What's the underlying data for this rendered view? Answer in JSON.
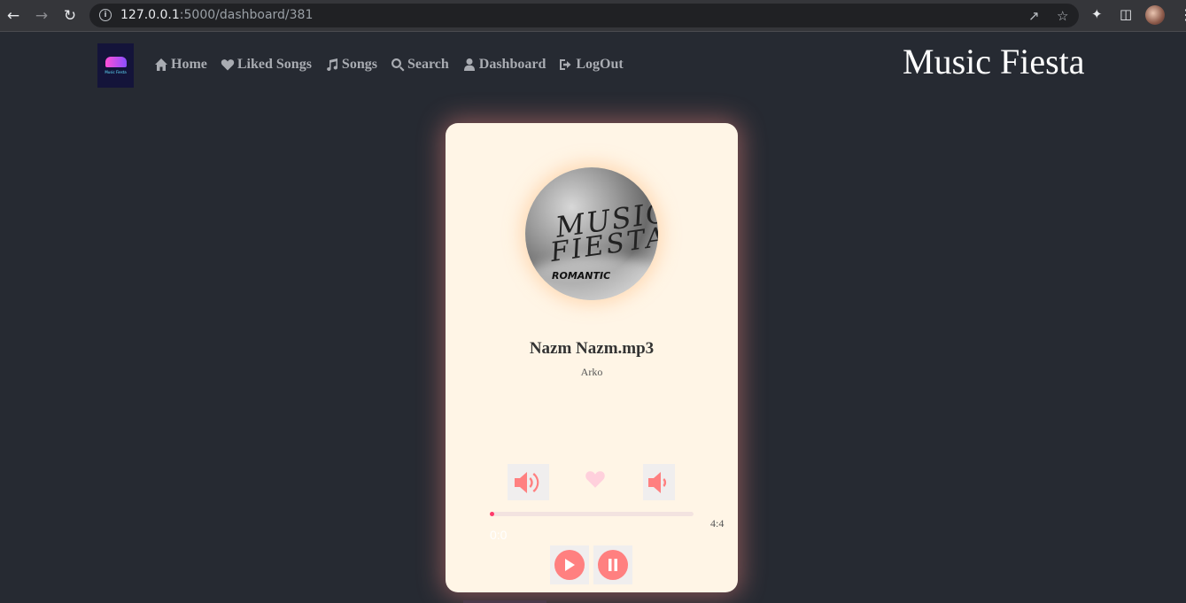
{
  "browser": {
    "url_host": "127.0.0.1",
    "url_path": ":5000/dashboard/381",
    "icons": [
      "back-icon",
      "forward-icon",
      "reload-icon",
      "info-icon",
      "share-icon",
      "star-icon",
      "extensions-icon",
      "sidepanel-icon",
      "profile-avatar",
      "menu-icon"
    ]
  },
  "site": {
    "logo_text": "Music Fiesta",
    "brand": "Music Fiesta",
    "nav": [
      {
        "label": "Home",
        "icon": "home-icon"
      },
      {
        "label": "Liked Songs",
        "icon": "heart-icon"
      },
      {
        "label": "Songs",
        "icon": "music-note-icon"
      },
      {
        "label": "Search",
        "icon": "search-icon"
      },
      {
        "label": "Dashboard",
        "icon": "user-icon"
      },
      {
        "label": "LogOut",
        "icon": "logout-icon"
      }
    ]
  },
  "player": {
    "cover_text": [
      "MUSIC",
      "FIESTA",
      "ROMANTIC"
    ],
    "title": "Nazm Nazm.mp3",
    "artist": "Arko",
    "current_time": "0:0",
    "total_time": "4:4",
    "progress": 0.02,
    "controls": [
      "volume-up-icon",
      "like-heart-icon",
      "volume-down-icon",
      "play-icon",
      "pause-icon"
    ],
    "colors": {
      "accent": "#ff8080",
      "progress": "#ff3a6a",
      "card": "#fff5e6",
      "background": "#262a32"
    }
  }
}
